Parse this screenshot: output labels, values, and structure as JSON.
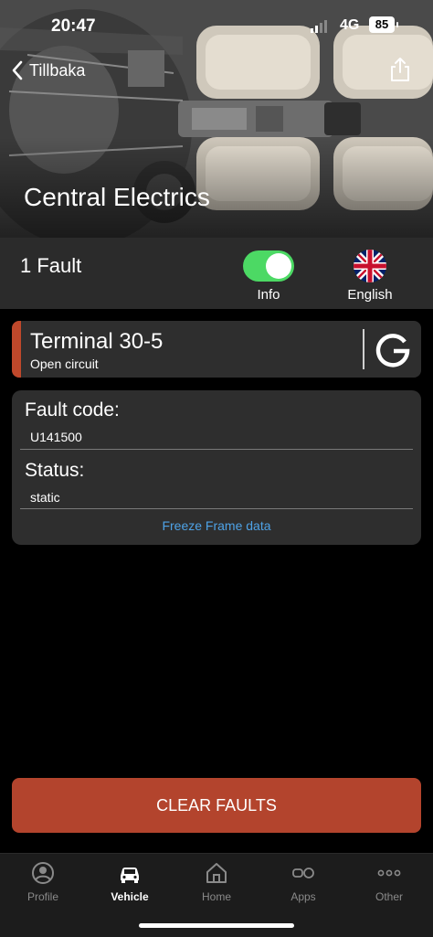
{
  "status": {
    "time": "20:47",
    "network": "4G",
    "battery": "85"
  },
  "header": {
    "back_label": "Tillbaka",
    "title": "Central Electrics"
  },
  "fault_summary": {
    "count_label": "1 Fault",
    "info_label": "Info",
    "info_toggle_on": true,
    "language_label": "English"
  },
  "fault": {
    "title": "Terminal 30-5",
    "subtitle": "Open circuit",
    "fault_code_label": "Fault code:",
    "fault_code": "U141500",
    "status_label": "Status:",
    "status_value": "static",
    "freeze_frame_link": "Freeze Frame data"
  },
  "actions": {
    "clear_label": "CLEAR FAULTS"
  },
  "colors": {
    "accent": "#c0482b",
    "clear_button": "#b3442d",
    "toggle_on": "#4cd964",
    "link": "#4ea2e6"
  },
  "tabbar": {
    "items": [
      {
        "label": "Profile",
        "icon": "profile-icon",
        "active": false
      },
      {
        "label": "Vehicle",
        "icon": "car-icon",
        "active": true
      },
      {
        "label": "Home",
        "icon": "home-icon",
        "active": false
      },
      {
        "label": "Apps",
        "icon": "apps-icon",
        "active": false
      },
      {
        "label": "Other",
        "icon": "more-dots-icon",
        "active": false
      }
    ]
  }
}
